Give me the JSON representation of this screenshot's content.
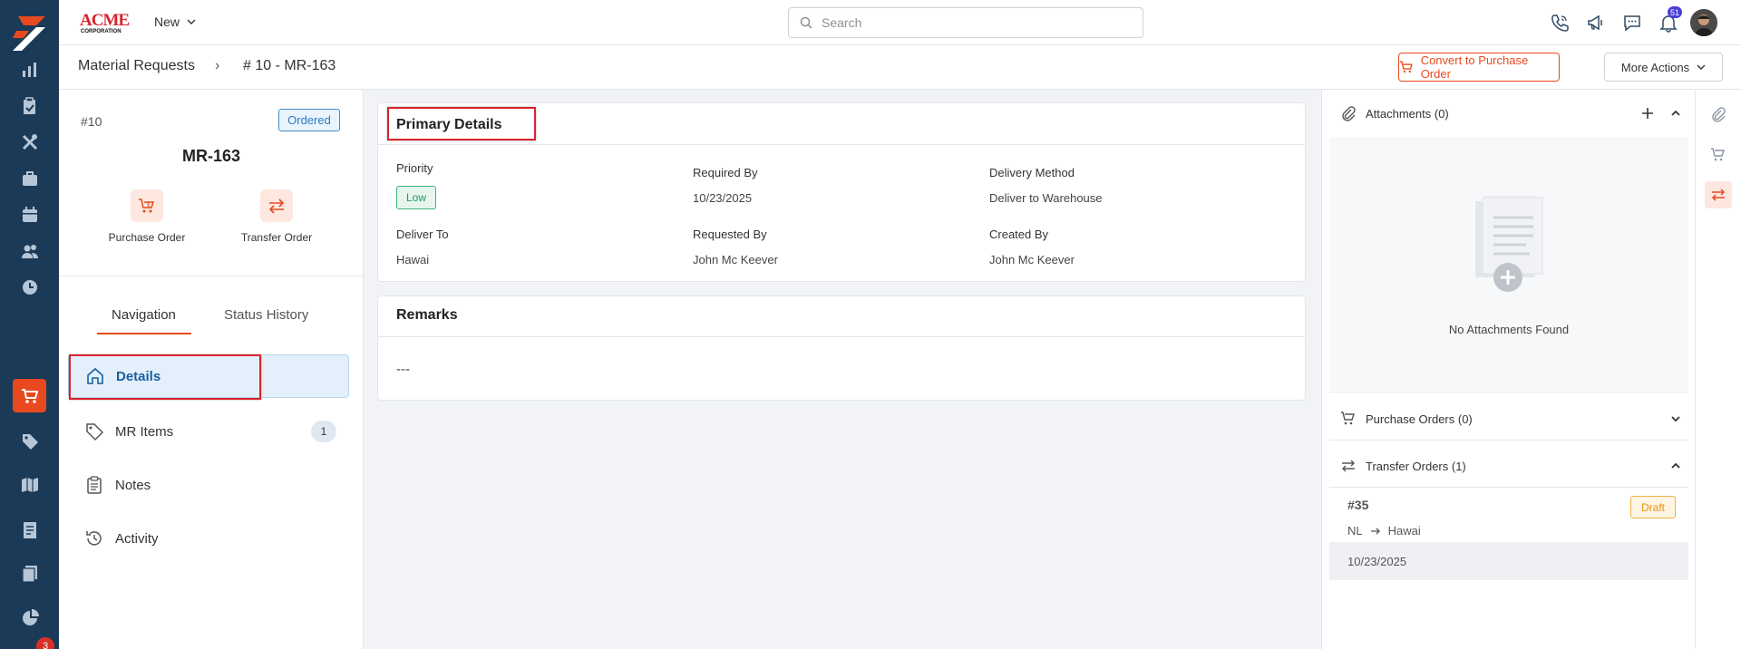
{
  "app": {
    "brand_name": "ACME CORPORATION",
    "new_label": "New",
    "search_placeholder": "Search",
    "notification_count": "51",
    "rail_badge_count": "3",
    "accent_color": "#e8491f",
    "rail_color": "#1b3a57"
  },
  "rail": {
    "items": [
      "reports-icon",
      "clipboard-icon",
      "tools-icon",
      "briefcase-icon",
      "calendar-icon",
      "users-icon",
      "clock-icon",
      "cart-icon",
      "tag-icon",
      "map-icon",
      "receipt-icon",
      "documents-icon",
      "pie-chart-icon"
    ],
    "active_item": "cart-icon"
  },
  "breadcrumb": {
    "parent": "Material Requests",
    "separator": "›",
    "current": "# 10 - MR-163"
  },
  "actions": {
    "convert_label": "Convert to Purchase Order",
    "more_label": "More Actions"
  },
  "record": {
    "number": "#10",
    "status": "Ordered",
    "id": "MR-163",
    "quick_actions": [
      {
        "label": "Purchase Order",
        "icon": "cart-dollar-icon"
      },
      {
        "label": "Transfer Order",
        "icon": "transfer-icon"
      }
    ]
  },
  "tabs": {
    "navigation": "Navigation",
    "status_history": "Status History",
    "active": "Navigation"
  },
  "nav": {
    "items": [
      {
        "label": "Details",
        "icon": "home-icon",
        "active": true
      },
      {
        "label": "MR Items",
        "icon": "tag-icon",
        "count": "1"
      },
      {
        "label": "Notes",
        "icon": "clipboard-icon"
      },
      {
        "label": "Activity",
        "icon": "history-icon"
      }
    ]
  },
  "primary": {
    "title": "Primary Details",
    "fields": {
      "priority_label": "Priority",
      "priority_value": "Low",
      "required_by_label": "Required By",
      "required_by_value": "10/23/2025",
      "delivery_method_label": "Delivery Method",
      "delivery_method_value": "Deliver to Warehouse",
      "deliver_to_label": "Deliver To",
      "deliver_to_value": "Hawai",
      "requested_by_label": "Requested By",
      "requested_by_value": "John Mc Keever",
      "created_by_label": "Created By",
      "created_by_value": "John Mc Keever"
    }
  },
  "remarks": {
    "title": "Remarks",
    "value": "---"
  },
  "right": {
    "attachments_title": "Attachments (0)",
    "attachments_empty": "No Attachments Found",
    "purchase_orders_title": "Purchase Orders (0)",
    "transfer_orders_title": "Transfer Orders (1)",
    "transfer_order": {
      "number": "#35",
      "status": "Draft",
      "from": "NL",
      "to": "Hawai",
      "date": "10/23/2025"
    }
  }
}
